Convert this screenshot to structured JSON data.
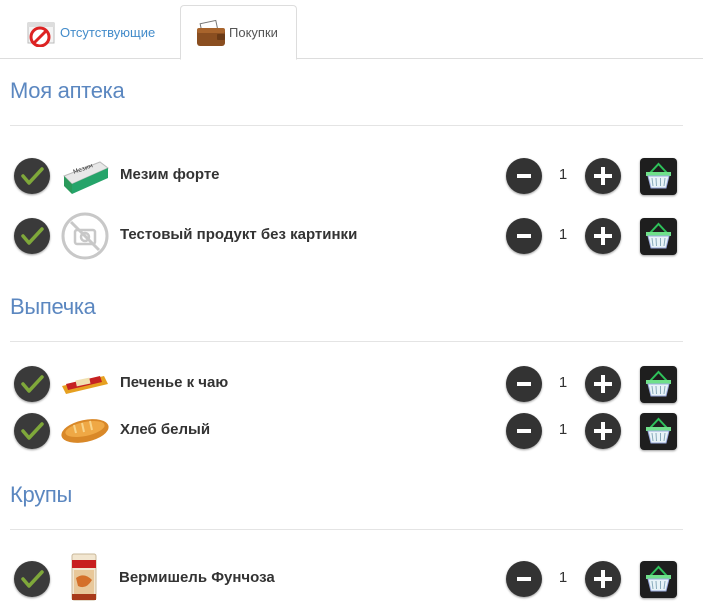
{
  "tabs": [
    {
      "label": "Отсутствующие",
      "icon": "absent-icon",
      "active": false
    },
    {
      "label": "Покупки",
      "icon": "wallet-icon",
      "active": true
    }
  ],
  "sections": [
    {
      "title": "Моя аптека",
      "items": [
        {
          "name": "Мезим форте",
          "qty": "1",
          "image": "mezim-box"
        },
        {
          "name": "Тестовый продукт без картинки",
          "qty": "1",
          "image": "no-photo"
        }
      ]
    },
    {
      "title": "Выпечка",
      "items": [
        {
          "name": "Печенье к чаю",
          "qty": "1",
          "image": "cookies-pack"
        },
        {
          "name": "Хлеб белый",
          "qty": "1",
          "image": "white-bread"
        }
      ]
    },
    {
      "title": "Крупы",
      "items": [
        {
          "name": "Вермишель Фунчоза",
          "qty": "1",
          "image": "funchoza-pack"
        }
      ]
    }
  ],
  "colors": {
    "section_title": "#5b87c0",
    "tab_link": "#428bca",
    "button_dark": "#333333",
    "check_green": "#7fa83a"
  }
}
